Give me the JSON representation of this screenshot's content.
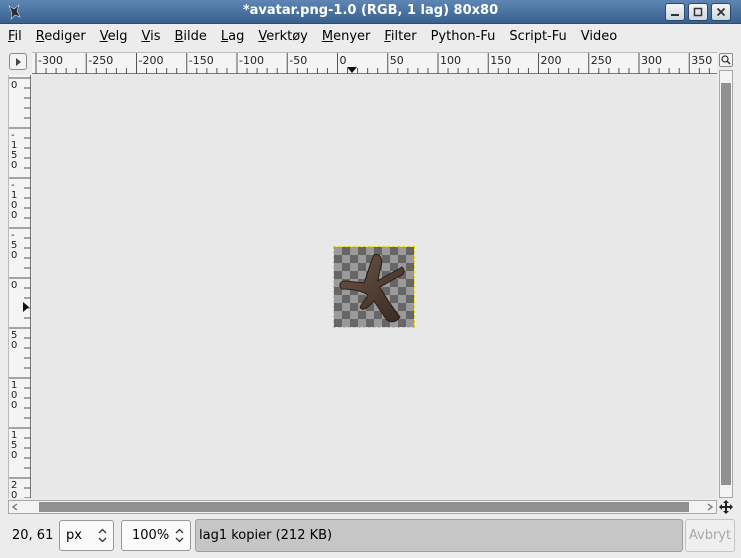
{
  "window": {
    "title": "*avatar.png-1.0 (RGB, 1 lag) 80x80"
  },
  "menubar": {
    "items": [
      {
        "key": "F",
        "rest": "il"
      },
      {
        "key": "R",
        "rest": "ediger"
      },
      {
        "key": "V",
        "rest": "elg"
      },
      {
        "key": "V",
        "rest": "is"
      },
      {
        "key": "B",
        "rest": "ilde"
      },
      {
        "key": "L",
        "rest": "ag"
      },
      {
        "key": "V",
        "rest": "erktøy"
      },
      {
        "key": "M",
        "rest": "enyer"
      },
      {
        "key": "F",
        "rest": "ilter"
      },
      {
        "key": "",
        "rest": "Python-Fu"
      },
      {
        "key": "",
        "rest": "Script-Fu"
      },
      {
        "key": "",
        "rest": "Video"
      }
    ]
  },
  "rulers": {
    "horizontal_labels": [
      "-300",
      "-250",
      "-200",
      "-150",
      "-100",
      "-50",
      "0",
      "50",
      "100",
      "150",
      "200",
      "250",
      "300",
      "350"
    ],
    "vertical_labels": [
      "0",
      "-150",
      "-100",
      "-50",
      "0",
      "50",
      "100",
      "150",
      "200"
    ]
  },
  "status": {
    "coords": "20, 61",
    "unit": "px",
    "zoom": "100%",
    "layer_info": "lag1 kopier (212 KB)",
    "cancel_label": "Avbryt"
  },
  "icons": {
    "app": "gimp-wilber-icon",
    "minimize": "minimize-icon",
    "maximize": "maximize-icon",
    "close": "close-icon",
    "menu_arrow": "menu-arrow-icon",
    "zoom": "zoom-icon",
    "navigate": "navigate-icon"
  },
  "colors": {
    "titlebar": "#4a75a5",
    "selection_outline": "#e8d800",
    "layer_info_bg": "#c6c6c6"
  }
}
